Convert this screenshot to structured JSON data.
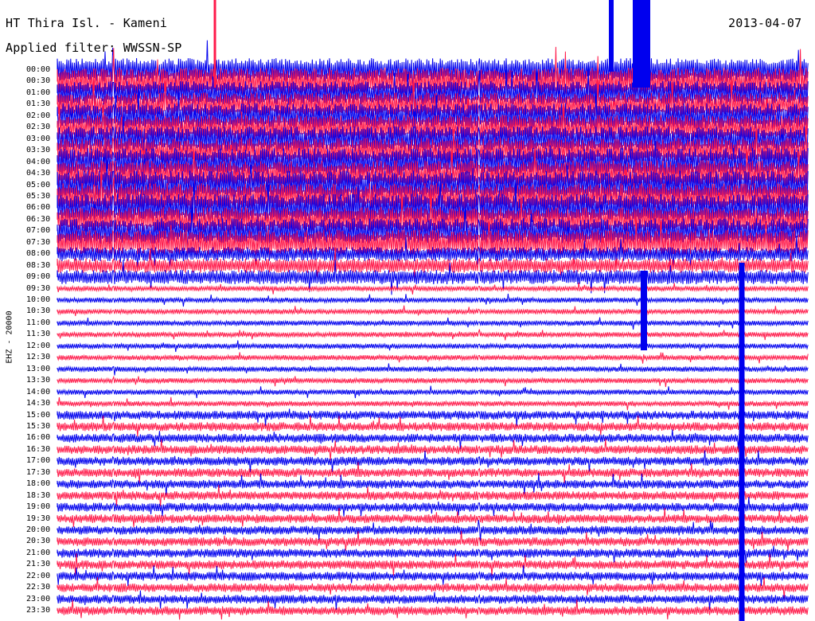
{
  "header": {
    "station": "HT Thira Isl. - Kameni",
    "date": "2013-04-07",
    "filter": "Applied filter: WWSSN-SP"
  },
  "channel": "EHZ - 20000",
  "colors": {
    "trace_a": "#0000ee",
    "trace_b": "#ff1a4a",
    "background": "#ffffff"
  },
  "time_labels": [
    "00:00",
    "00:30",
    "01:00",
    "01:30",
    "02:00",
    "02:30",
    "03:00",
    "03:30",
    "04:00",
    "04:30",
    "05:00",
    "05:30",
    "06:00",
    "06:30",
    "07:00",
    "07:30",
    "08:00",
    "08:30",
    "09:00",
    "09:30",
    "10:00",
    "10:30",
    "11:00",
    "11:30",
    "12:00",
    "12:30",
    "13:00",
    "13:30",
    "14:00",
    "14:30",
    "15:00",
    "15:30",
    "16:00",
    "16:30",
    "17:00",
    "17:30",
    "18:00",
    "18:30",
    "19:00",
    "19:30",
    "20:00",
    "20:30",
    "21:00",
    "21:30",
    "22:00",
    "22:30",
    "23:00",
    "23:30"
  ]
}
